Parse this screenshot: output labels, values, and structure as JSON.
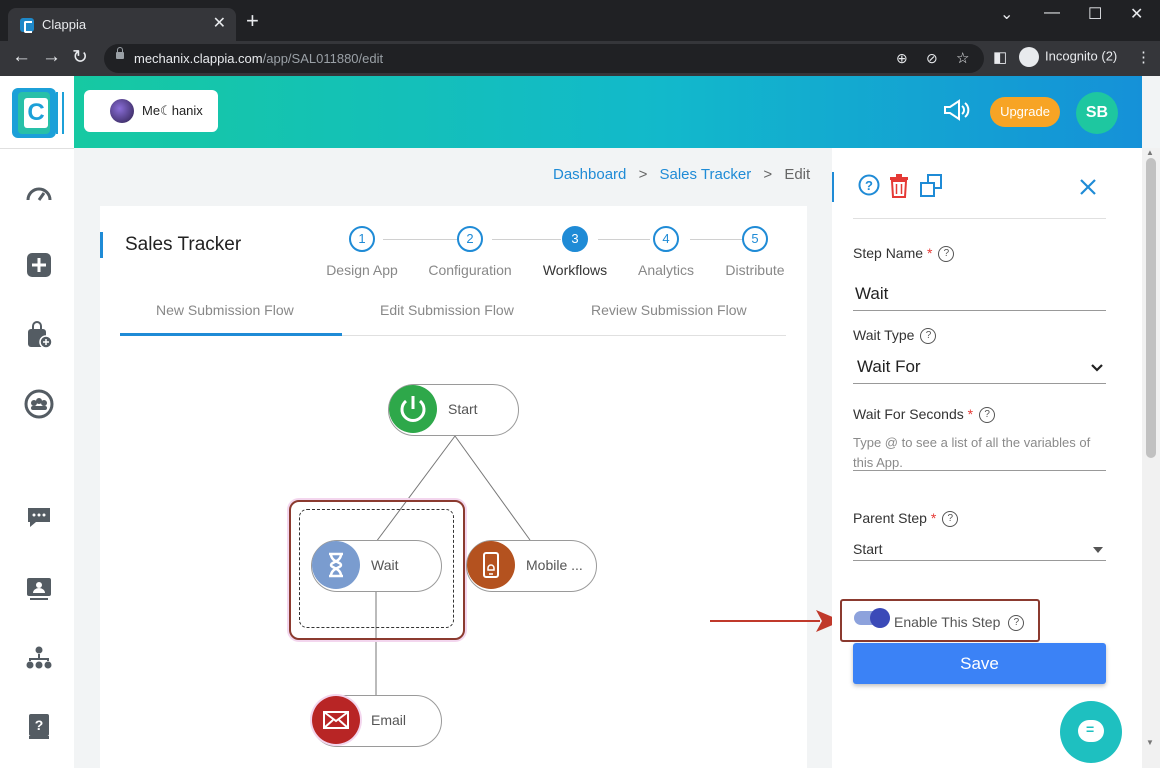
{
  "browser": {
    "tab_title": "Clappia",
    "tab_close": "✕",
    "new_tab": "+",
    "url_host": "mechanix.clappia.com",
    "url_path": "/app/SAL011880/edit",
    "incognito_label": "Incognito (2)",
    "window_controls": [
      "⌄",
      "—",
      "☐",
      "✕"
    ]
  },
  "sidebar": {
    "icons": [
      "speedometer-icon",
      "plus-square-icon",
      "shopping-bag-add-icon",
      "group-icon",
      "chat-icon",
      "id-card-icon",
      "org-chart-icon",
      "help-book-icon"
    ]
  },
  "header": {
    "workspace_name": "Me☾hanix",
    "upgrade_label": "Upgrade",
    "avatar_initials": "SB"
  },
  "breadcrumb": {
    "items": [
      "Dashboard",
      "Sales Tracker",
      "Edit"
    ],
    "separator": ">"
  },
  "app": {
    "title": "Sales Tracker",
    "steps": [
      {
        "num": "1",
        "label": "Design App"
      },
      {
        "num": "2",
        "label": "Configuration"
      },
      {
        "num": "3",
        "label": "Workflows"
      },
      {
        "num": "4",
        "label": "Analytics"
      },
      {
        "num": "5",
        "label": "Distribute"
      }
    ],
    "active_step": 3,
    "flow_tabs": [
      "New Submission Flow",
      "Edit Submission Flow",
      "Review Submission Flow"
    ]
  },
  "flow": {
    "nodes": {
      "start": "Start",
      "wait": "Wait",
      "mobile": "Mobile ...",
      "email": "Email"
    }
  },
  "panel": {
    "step_name_label": "Step Name",
    "step_name_value": "Wait",
    "wait_type_label": "Wait Type",
    "wait_type_value": "Wait For",
    "wait_seconds_label": "Wait For Seconds",
    "wait_seconds_placeholder": "Type @ to see a list of all the variables of this App.",
    "parent_step_label": "Parent Step",
    "parent_step_value": "Start",
    "enable_label": "Enable This Step",
    "save_label": "Save",
    "required_mark": "*",
    "help_mark": "?"
  },
  "colors": {
    "accent": "#1f8bd6",
    "start_node": "#2ea84a",
    "wait_node": "#7a9ccf",
    "mobile_node": "#b4521f",
    "email_node": "#b82525",
    "highlight": "#8b3a2f"
  }
}
